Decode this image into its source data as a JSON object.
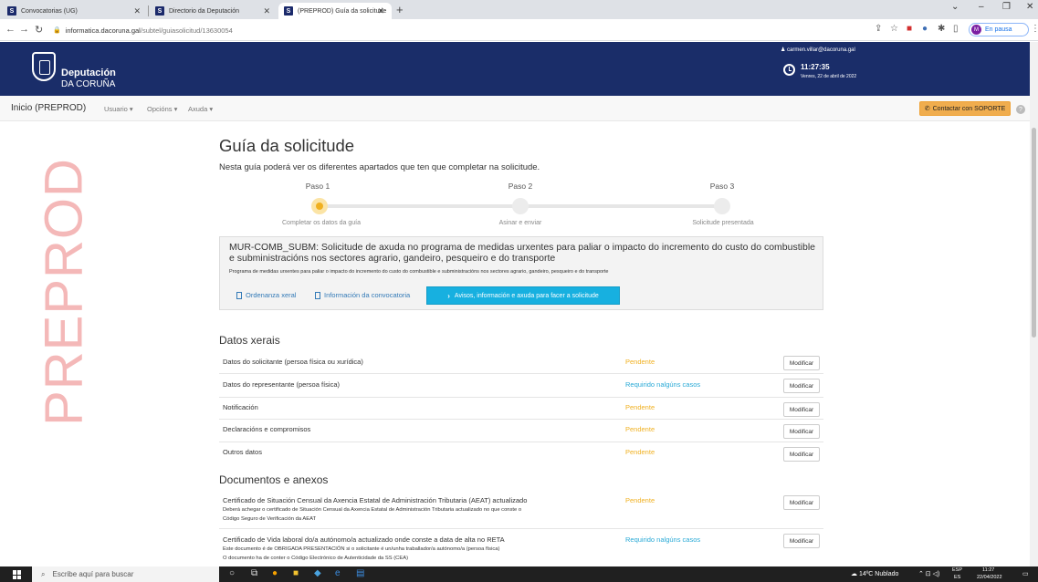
{
  "browser": {
    "tabs": [
      {
        "label": "Convocatorias (UG)"
      },
      {
        "label": "Directorio da Deputación"
      },
      {
        "label": "(PREPROD) Guía da solicitude"
      }
    ],
    "url_domain": "informatica.dacoruna.gal",
    "url_path": "/subtel/guiasolicitud/13630054",
    "profile_initial": "M",
    "profile_status": "En pausa"
  },
  "header": {
    "logo_line1": "Deputación",
    "logo_line2": "DA CORUÑA",
    "user_email": "carmen.villar@dacoruna.gal",
    "time": "11:27:35",
    "date": "Venres, 22 de abril de 2022"
  },
  "menu": {
    "brand": "Inicio (PREPROD)",
    "items": [
      "Usuario",
      "Opcións",
      "Axuda"
    ],
    "support_button": "Contactar con SOPORTE"
  },
  "watermark": "PREPROD",
  "main": {
    "title": "Guía da solicitude",
    "intro": "Nesta guía poderá ver os diferentes apartados que ten que completar na solicitude.",
    "steps": [
      {
        "label": "Paso 1",
        "desc": "Completar os datos da guía"
      },
      {
        "label": "Paso 2",
        "desc": "Asinar e enviar"
      },
      {
        "label": "Paso 3",
        "desc": "Solicitude presentada"
      }
    ],
    "convocatoria": {
      "title": "MUR-COMB_SUBM: Solicitude de axuda no programa de medidas urxentes para paliar o impacto do incremento do custo do combustible e subministracións nos sectores agrario, gandeiro, pesqueiro e do transporte",
      "subtitle": "Programa de medidas urxentes para paliar o impacto do incremento do custo do combustible e subministracións nos sectores agrario, gandeiro, pesqueiro e do transporte",
      "link1": "Ordenanza xeral",
      "link2": "Información da convocatoria",
      "button": "Avisos, información e axuda para facer a solicitude"
    },
    "datos_title": "Datos xerais",
    "datos": [
      {
        "label": "Datos do solicitante (persoa física ou xurídica)",
        "status": "Pendente",
        "status_type": "pend",
        "action": "Modificar"
      },
      {
        "label": "Datos do representante (persoa física)",
        "status": "Requirido nalgúns casos",
        "status_type": "req",
        "action": "Modificar"
      },
      {
        "label": "Notificación",
        "status": "Pendente",
        "status_type": "pend",
        "action": "Modificar"
      },
      {
        "label": "Declaracións e compromisos",
        "status": "Pendente",
        "status_type": "pend",
        "action": "Modificar"
      },
      {
        "label": "Outros datos",
        "status": "Pendente",
        "status_type": "pend",
        "action": "Modificar"
      }
    ],
    "docs_title": "Documentos e anexos",
    "docs": [
      {
        "label": "Certificado de Situación Censual da Axencia Estatal de Administración Tributaria (AEAT) actualizado",
        "note1": "Deberá achegar o certificado de Situación Censual da Axencia Estatal de Administración Tributaria actualizado no que conste o",
        "note2": "Código Seguro de Verificación da AEAT",
        "status": "Pendente",
        "action": "Modificar"
      },
      {
        "label": "Certificado de Vida laboral do/a autónomo/a actualizado onde conste a data de alta no RETA",
        "note1": "Este documento é de OBRIGADA PRESENTACIÓN si o solicitante é un/unha traballador/a autónomo/a (persoa física)",
        "note2": "O documento ha de conter o Código Electrónico de Autenticidade da SS (CEA)",
        "status": "Requirido nalgúns casos",
        "action": "Modificar"
      }
    ]
  },
  "taskbar": {
    "search_placeholder": "Escribe aquí para buscar",
    "weather": "14ºC Nublado",
    "lang1": "ESP",
    "lang2": "ES",
    "time": "11:27",
    "date": "22/04/2022"
  },
  "colors": {
    "header_bg": "#1a2d69",
    "pending": "#f0b020",
    "required": "#28a9d6",
    "support": "#f0ad4e",
    "info_button": "#17b0e0"
  }
}
